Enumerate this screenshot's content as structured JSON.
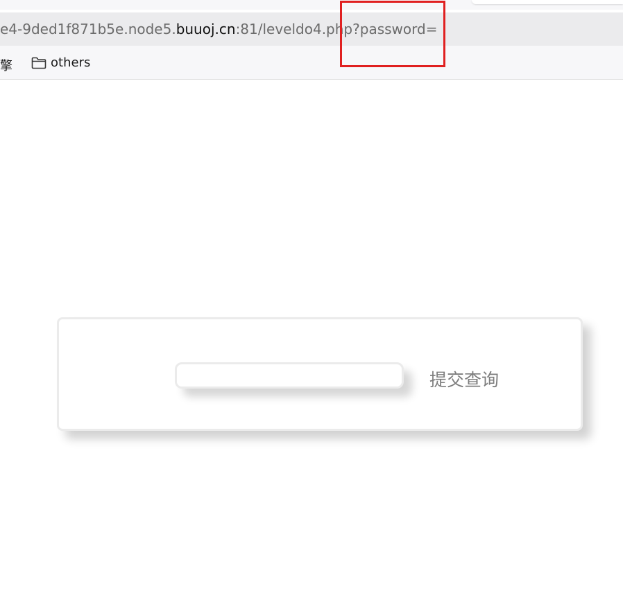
{
  "browser": {
    "url": {
      "prefix": "e4-9ded1f871b5e.node5.",
      "domain": "buuoj.cn",
      "suffix": ":81/leveldo4.php?password="
    },
    "bookmarks": {
      "cut_label": "擎",
      "folder_label": "others"
    }
  },
  "form": {
    "password_value": "",
    "submit_label": "提交查询"
  },
  "annotation": {
    "highlight_color": "#e02020"
  }
}
